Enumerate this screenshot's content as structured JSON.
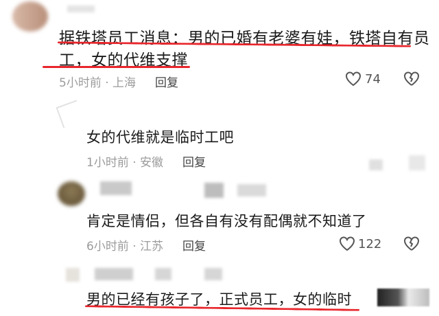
{
  "comments": [
    {
      "text_line1": "据铁塔员工消息：男的已婚有老婆有娃，铁塔自有员",
      "text_line2": "工，女的代维支撑",
      "time": "5小时前 · 上海",
      "reply": "回复",
      "likes": "74"
    },
    {
      "text": "女的代维就是临时工吧",
      "time": "1小时前 · 安徽",
      "reply": "回复"
    },
    {
      "text": "肯定是情侣，但各自有没有配偶就不知道了",
      "time": "6小时前 · 江苏",
      "reply": "回复",
      "likes": "122"
    },
    {
      "text": "男的已经有孩子了，正式员工，女的临时"
    }
  ],
  "icons": {
    "like": "heart-outline-icon",
    "dislike": "broken-heart-icon"
  },
  "colors": {
    "highlight_underline": "#e8262c"
  }
}
